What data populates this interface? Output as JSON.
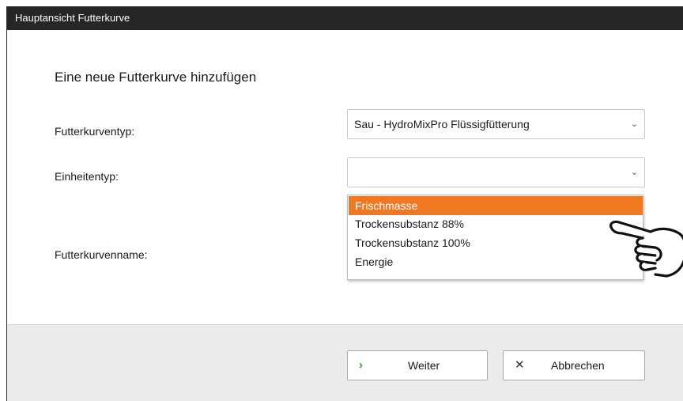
{
  "window": {
    "title": "Hauptansicht Futterkurve"
  },
  "form": {
    "heading": "Eine neue Futterkurve hinzufügen",
    "curve_type": {
      "label": "Futterkurventyp:",
      "value": "Sau - HydroMixPro Flüssigfütterung"
    },
    "unit_type": {
      "label": "Einheitentyp:",
      "value": "",
      "options": [
        "Frischmasse",
        "Trockensubstanz 88%",
        "Trockensubstanz 100%",
        "Energie"
      ],
      "highlighted": "Frischmasse"
    },
    "curve_name": {
      "label": "Futterkurvenname:"
    }
  },
  "footer": {
    "next_label": "Weiter",
    "cancel_label": "Abbrechen"
  },
  "colors": {
    "titlebar": "#262626",
    "highlight": "#f07820",
    "footer": "#ebebeb"
  },
  "icons": {
    "next": "chevron-right-icon",
    "cancel": "close-icon",
    "pointer": "pointing-hand-icon"
  }
}
